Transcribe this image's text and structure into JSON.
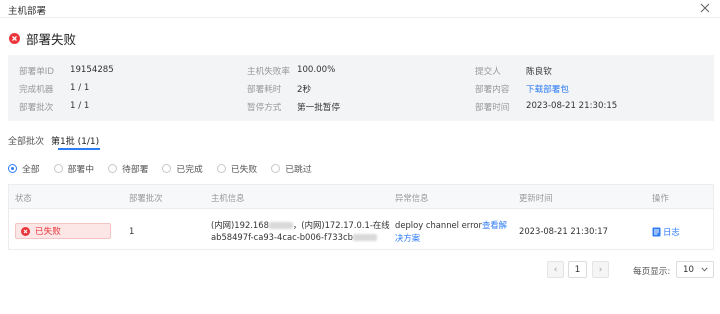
{
  "dialog": {
    "title": "主机部署"
  },
  "status": {
    "text": "部署失败"
  },
  "info": {
    "deploy_id_label": "部署单ID",
    "deploy_id_value": "19154285",
    "machines_done_label": "完成机器",
    "machines_done_value": "1 / 1",
    "batch_label": "部署批次",
    "batch_value": "1 / 1",
    "failure_rate_label": "主机失败率",
    "failure_rate_value": "100.00%",
    "duration_label": "部署耗时",
    "duration_value": "2秒",
    "pause_mode_label": "暂停方式",
    "pause_mode_value": "第一批暂停",
    "submitter_label": "提交人",
    "submitter_value": "陈良钦",
    "content_label": "部署内容",
    "content_link": "下载部署包",
    "time_label": "部署时间",
    "time_value": "2023-08-21 21:30:15"
  },
  "tabs": [
    "全部批次",
    "第1批 (1/1)"
  ],
  "filters": [
    "全部",
    "部署中",
    "待部署",
    "已完成",
    "已失败",
    "已跳过"
  ],
  "table": {
    "headers": [
      "状态",
      "部署批次",
      "主机信息",
      "异常信息",
      "更新时间",
      "操作"
    ],
    "rows": [
      {
        "status": "已失败",
        "batch": "1",
        "host_line1_a": "(内网)192.168",
        "host_line1_b": "，(内网)172.17.0.1-在线",
        "host_line2": "ab58497f-ca93-4cac-b006-f733cb",
        "error_text": "deploy channel error",
        "error_link_1": "查看解",
        "error_link_2": "决方案",
        "updated": "2023-08-21 21:30:17",
        "action": "日志"
      }
    ]
  },
  "pagination": {
    "prev": "‹",
    "current_page": "1",
    "next": "›",
    "page_size_label": "每页显示:",
    "page_size_value": "10"
  },
  "colors": {
    "accent": "#2f7df6",
    "error": "#e8363b",
    "panel_bg": "#f3f4f6"
  },
  "icons": [
    "close-icon",
    "error-icon",
    "log-document-icon",
    "chevron-down-icon"
  ]
}
